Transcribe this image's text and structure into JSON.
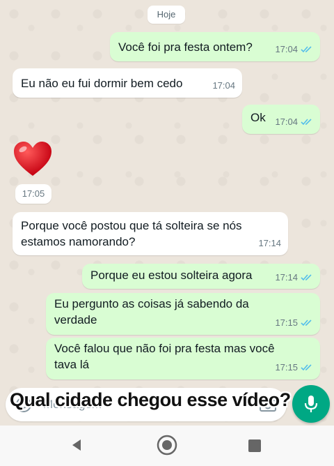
{
  "chat": {
    "date_chip": "Hoje",
    "messages": [
      {
        "text": "Você foi pra festa ontem?",
        "time": "17:04"
      },
      {
        "text": "Eu não eu fui dormir bem cedo",
        "time": "17:04"
      },
      {
        "text": "Ok",
        "time": "17:04"
      },
      {
        "text": "❤️",
        "time": "17:05"
      },
      {
        "text_line1": "Porque você postou que tá solteira se nós",
        "text_line2": "estamos namorando?",
        "time": "17:14"
      },
      {
        "text": "Porque eu estou solteira agora",
        "time": "17:14"
      },
      {
        "text_line1": "Eu pergunto as coisas já sabendo da",
        "text_line2": "verdade",
        "time": "17:15"
      },
      {
        "text_line1": "Você falou que não foi pra festa mas você",
        "text_line2": "tava lá",
        "time": "17:15"
      }
    ]
  },
  "composer": {
    "placeholder": "Mensagem"
  },
  "overlay_caption": "Qual cidade chegou esse vídeo?",
  "colors": {
    "outgoing_bubble": "#d9fdd3",
    "incoming_bubble": "#ffffff",
    "read_ticks": "#53bdeb",
    "accent": "#00a884"
  },
  "icons": [
    "emoji-icon",
    "camera-icon",
    "mic-icon",
    "read-receipt-icon",
    "heart-emoji",
    "back-nav-icon",
    "home-nav-icon",
    "recents-nav-icon"
  ]
}
